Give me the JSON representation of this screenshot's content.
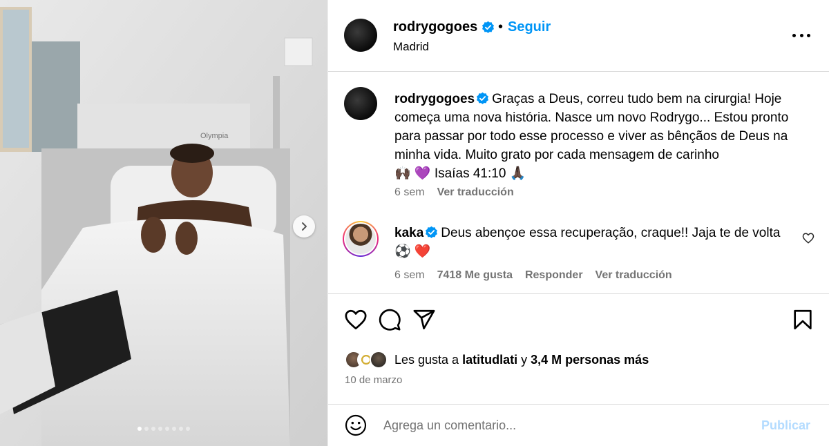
{
  "author": {
    "username": "rodrygogoes",
    "verified": true,
    "follow_label": "Seguir",
    "separator": "•",
    "location": "Madrid"
  },
  "caption": {
    "username": "rodrygogoes",
    "text": "Graças a Deus, correu tudo bem na cirurgia! Hoje começa uma nova história. Nasce um novo Rodrygo... Estou pronto para passar por todo esse processo e viver as bênçãos de Deus na minha vida. Muito grato por cada mensagem de carinho",
    "emoji_line": "🙌🏿 💜  Isaías 41:10 🙏🏿",
    "time": "6 sem",
    "translate": "Ver traducción"
  },
  "comment": {
    "username": "kaka",
    "text": "Deus abençoe essa recuperação, craque!! Jaja te de volta ⚽ ❤️",
    "time": "6 sem",
    "likes": "7418 Me gusta",
    "reply": "Responder",
    "translate": "Ver traducción"
  },
  "likes": {
    "prefix": "Les gusta a",
    "user": "latitudlati",
    "connector": "y",
    "others": "3,4 M personas más"
  },
  "date": "10 de marzo",
  "comment_box": {
    "placeholder": "Agrega un comentario...",
    "publish": "Publicar"
  },
  "media": {
    "slide_count": 8,
    "active_slide": 1
  },
  "icons": {
    "like": "heart-icon",
    "comment": "comment-icon",
    "share": "share-icon",
    "save": "bookmark-icon",
    "more": "more-icon",
    "emoji": "emoji-icon",
    "next": "chevron-right-icon"
  },
  "colors": {
    "link": "#0095f6",
    "verified": "#0095f6",
    "muted": "#737373",
    "publish_disabled": "#b3dbff"
  }
}
